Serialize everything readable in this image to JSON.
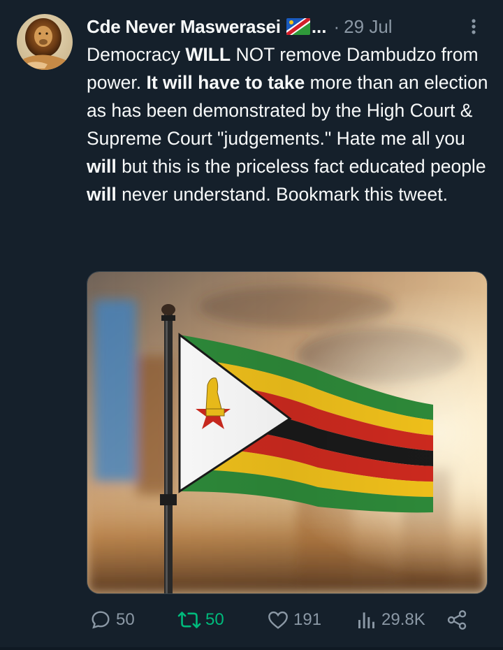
{
  "author": {
    "name": "Cde Never Maswerasei",
    "truncation": "...",
    "separator": "·",
    "date": "29 Jul",
    "flag_emoji": "namibia-flag-emoji"
  },
  "tweet": {
    "segments": [
      {
        "text": "Democracy ",
        "bold": false
      },
      {
        "text": "WILL",
        "bold": true
      },
      {
        "text": " NOT remove Dambudzo from power. ",
        "bold": false
      },
      {
        "text": "It will have to take",
        "bold": true
      },
      {
        "text": " more than an election as has been demonstrated by the High Court & Supreme Court \"judgements.\" Hate me all you ",
        "bold": false
      },
      {
        "text": "will",
        "bold": true
      },
      {
        "text": " but this is the priceless fact educated people ",
        "bold": false
      },
      {
        "text": "will",
        "bold": true
      },
      {
        "text": " never understand. Bookmark this tweet.",
        "bold": false
      }
    ]
  },
  "media": {
    "subject": "zimbabwe-flag-photo"
  },
  "actions": {
    "replies": "50",
    "retweets": "50",
    "likes": "191",
    "views": "29.8K"
  },
  "colors": {
    "background": "#15202b",
    "text": "#f7f9f9",
    "muted": "#8b98a5",
    "retweet_active": "#00ba7c"
  }
}
